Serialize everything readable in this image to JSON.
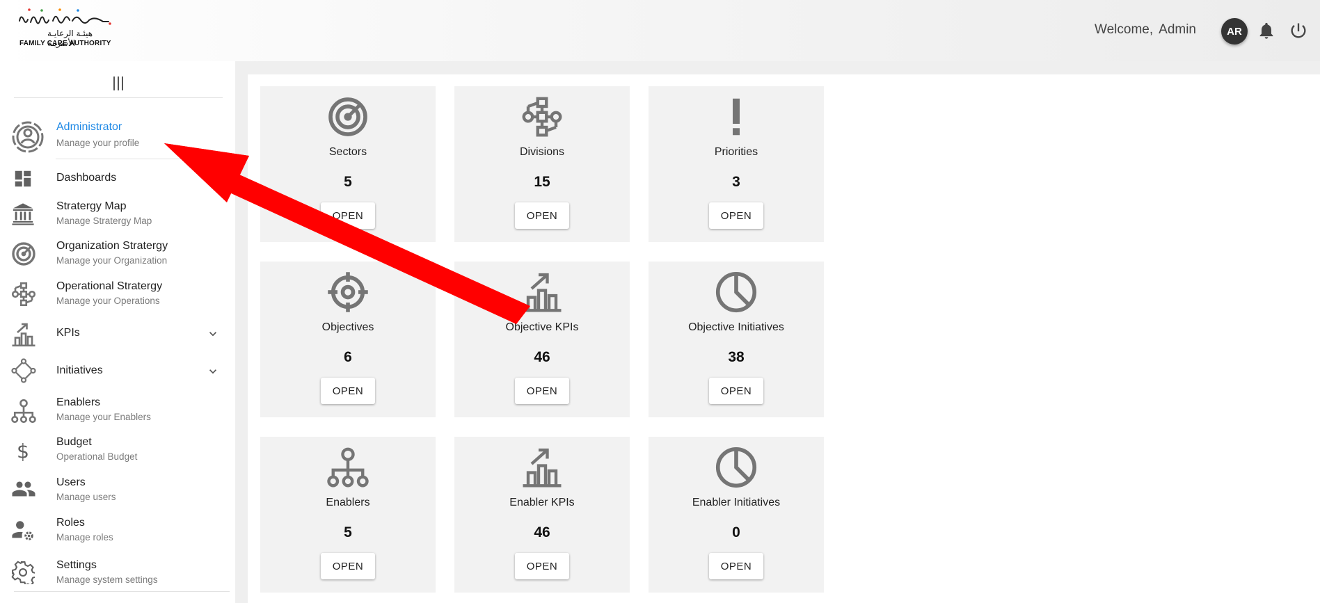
{
  "header": {
    "logo_arabic": "هيئـة الرعايـة الأسريـة",
    "logo_english": "FAMILY CARE AUTHORITY",
    "welcome_text": "Welcome,",
    "user_name": "Admin",
    "avatar_initials": "AR",
    "icons": [
      "bell-icon",
      "power-icon"
    ]
  },
  "sidebar": {
    "profile": {
      "title": "Administrator",
      "subtitle": "Manage your profile",
      "title_color": "#1e88e5"
    },
    "items": [
      {
        "title": "Dashboards",
        "subtitle": "",
        "icon": "dashboard-icon"
      },
      {
        "title": "Stratergy Map",
        "subtitle": "Manage Stratergy Map",
        "icon": "bank-icon"
      },
      {
        "title": "Organization Stratergy",
        "subtitle": "Manage your Organization",
        "icon": "target-icon"
      },
      {
        "title": "Operational Stratergy",
        "subtitle": "Manage your Operations",
        "icon": "network-icon"
      },
      {
        "title": "KPIs",
        "subtitle": "",
        "icon": "chart-up-icon",
        "expandable": true
      },
      {
        "title": "Initiatives",
        "subtitle": "",
        "icon": "diamond-nodes-icon",
        "expandable": true
      },
      {
        "title": "Enablers",
        "subtitle": "Manage your Enablers",
        "icon": "hierarchy-icon"
      },
      {
        "title": "Budget",
        "subtitle": "Operational Budget",
        "icon": "dollar-icon"
      },
      {
        "title": "Users",
        "subtitle": "Manage users",
        "icon": "users-icon"
      },
      {
        "title": "Roles",
        "subtitle": "Manage roles",
        "icon": "user-gear-icon"
      },
      {
        "title": "Settings",
        "subtitle": "Manage system settings",
        "icon": "gear-icon"
      }
    ]
  },
  "cards": [
    {
      "label": "Sectors",
      "count": "5",
      "button": "OPEN",
      "icon": "target-icon"
    },
    {
      "label": "Divisions",
      "count": "15",
      "button": "OPEN",
      "icon": "network-icon"
    },
    {
      "label": "Priorities",
      "count": "3",
      "button": "OPEN",
      "icon": "exclamation-icon"
    },
    {
      "label": "Objectives",
      "count": "6",
      "button": "OPEN",
      "icon": "crosshair-icon"
    },
    {
      "label": "Objective KPIs",
      "count": "46",
      "button": "OPEN",
      "icon": "chart-up-icon"
    },
    {
      "label": "Objective Initiatives",
      "count": "38",
      "button": "OPEN",
      "icon": "pie-icon"
    },
    {
      "label": "Enablers",
      "count": "5",
      "button": "OPEN",
      "icon": "hierarchy-icon"
    },
    {
      "label": "Enabler KPIs",
      "count": "46",
      "button": "OPEN",
      "icon": "chart-up-icon"
    },
    {
      "label": "Enabler Initiatives",
      "count": "0",
      "button": "OPEN",
      "icon": "pie-icon"
    }
  ],
  "colors": {
    "icon_gray": "#757575",
    "annotation_red": "#ff0000",
    "link_blue": "#1e88e5"
  }
}
